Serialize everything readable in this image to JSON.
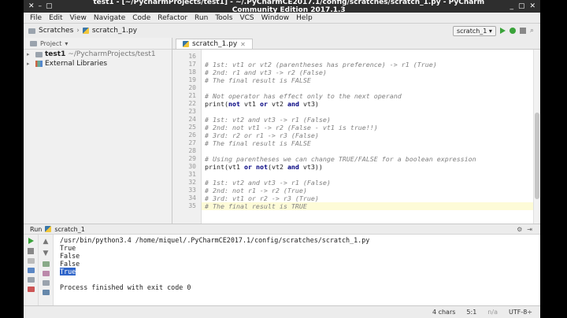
{
  "window": {
    "title": "test1 - [~/PycharmProjects/test1] - ~/.PyCharmCE2017.1/config/scratches/scratch_1.py - PyCharm Community Edition 2017.1.3"
  },
  "menu": [
    "File",
    "Edit",
    "View",
    "Navigate",
    "Code",
    "Refactor",
    "Run",
    "Tools",
    "VCS",
    "Window",
    "Help"
  ],
  "breadcrumb": {
    "root": "Scratches",
    "file": "scratch_1.py"
  },
  "run_config": "scratch_1",
  "project_panel": {
    "header": "Project",
    "root": "test1",
    "root_path": "~/PycharmProjects/test1",
    "libraries": "External Libraries"
  },
  "editor": {
    "tab": "scratch_1.py",
    "line_numbers": [
      "16",
      "17",
      "18",
      "19",
      "20",
      "21",
      "22",
      "23",
      "24",
      "25",
      "26",
      "27",
      "28",
      "29",
      "30",
      "31",
      "32",
      "33",
      "34",
      "35"
    ],
    "lines": [
      "",
      "# 1st: vt1 or vt2 (parentheses has preference) -> r1 (True)",
      "# 2nd: r1 and vt3 -> r2 (False)",
      "# The final result is FALSE",
      "",
      "# Not operator has effect only to the next operand",
      "print(not vt1 or vt2 and vt3)",
      "",
      "# 1st: vt2 and vt3 -> r1 (False)",
      "# 2nd: not vt1 -> r2 (False - vt1 is true!!)",
      "# 3rd: r2 or r1 -> r3 (False)",
      "# The final result is FALSE",
      "",
      "# Using parentheses we can change TRUE/FALSE for a boolean expression",
      "print(vt1 or not(vt2 and vt3))",
      "",
      "# 1st: vt2 and vt3 -> r1 (False)",
      "# 2nd: not r1 -> r2 (True)",
      "# 3rd: vt1 or r2 -> r3 (True)",
      "# The final result is TRUE"
    ]
  },
  "run_panel": {
    "label": "Run",
    "tab": "scratch_1",
    "console": [
      "/usr/bin/python3.4 /home/miquel/.PyCharmCE2017.1/config/scratches/scratch_1.py",
      "True",
      "False",
      "False",
      "True",
      "",
      "Process finished with exit code 0"
    ]
  },
  "statusbar": {
    "chars": "4 chars",
    "position": "5:1",
    "na": "n/a",
    "encoding": "UTF-8÷"
  }
}
